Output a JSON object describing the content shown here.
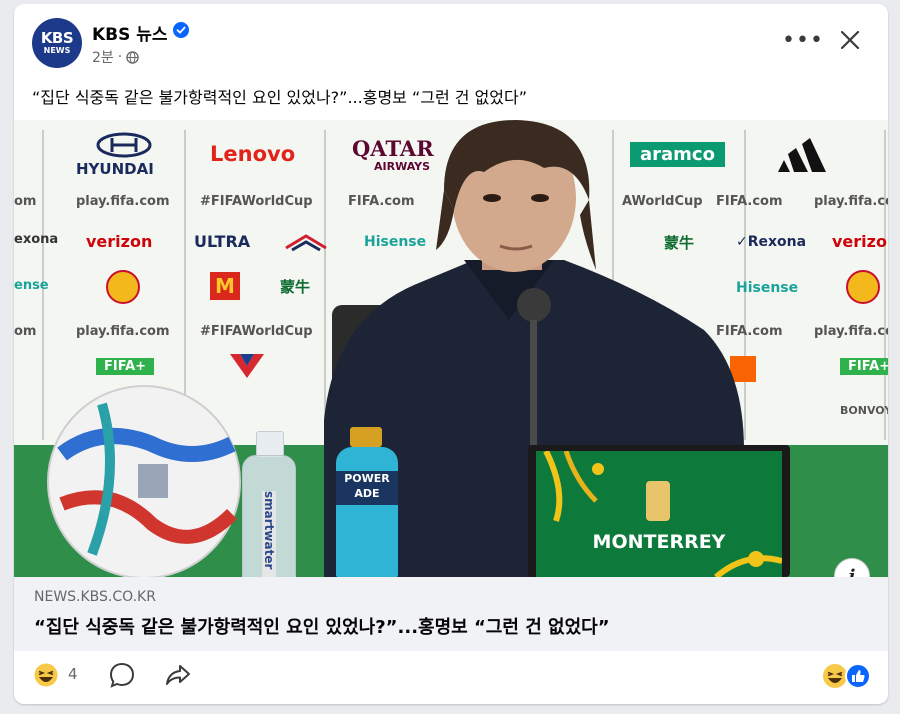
{
  "post": {
    "page_name": "KBS 뉴스",
    "avatar_text": "KBS",
    "avatar_sub": "NEWS",
    "time": "2분",
    "separator": "·",
    "text": "“집단 식중독 같은 불가항력적인 요인 있었나?”...홍명보 “그런 건 없었다”"
  },
  "header": {
    "more_label": "•••",
    "verified_icon": "verified-badge-icon",
    "privacy_icon": "globe-icon",
    "close_icon": "close-icon"
  },
  "photo": {
    "sponsors": {
      "hyundai": "HYUNDAI",
      "lenovo": "Lenovo",
      "qatar": "QATAR",
      "qatar_sub": "AIRWAYS",
      "aramco": "aramco",
      "playfifa": "play.fifa.com",
      "fifawc": "#FIFAWorldCup",
      "fifacom": "FIFA.com",
      "awc": "AWorldCup",
      "verizon": "verizon",
      "ultra": "ULTRA",
      "hisense": "Hisense",
      "rexona": "✓Rexona",
      "mengniu": "蒙牛",
      "fifaplus": "FIFA+",
      "bonvoy": "BONVOY",
      "exona": "exona",
      "ense": "ense",
      "om": "om"
    },
    "bottle_label": "POWER ADE",
    "water_label": "smartwater",
    "laptop_text": "MONTERREY",
    "info_label": "i"
  },
  "link_preview": {
    "domain": "NEWS.KBS.CO.KR",
    "title": "“집단 식중독 같은 불가항력적인 요인 있었나?”...홍명보 “그런 건 없었다”"
  },
  "actions": {
    "reaction_count": "4",
    "reaction_icon": "haha-reaction-icon",
    "comment_icon": "comment-icon",
    "share_icon": "share-icon"
  },
  "colors": {
    "fb_blue": "#0866ff",
    "kbs_blue": "#1d3a8a",
    "meta_gray": "#65676b",
    "preview_bg": "#f0f2f5"
  }
}
